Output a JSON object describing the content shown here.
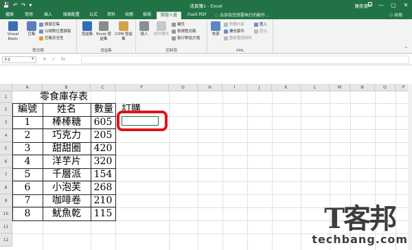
{
  "titlebar": {
    "doc_title": "活頁簿1 - Excel",
    "user": "陳奕安",
    "qat": {
      "save": "💾",
      "undo": "↶",
      "redo": "↷",
      "more": "▾"
    },
    "win": {
      "ribbon_opts": "▭",
      "minimize": "—",
      "maximize": "▢",
      "close": "✕"
    }
  },
  "ribbon_tabs": [
    "檔案",
    "常用",
    "插入",
    "版面配置",
    "公式",
    "資料",
    "校閱",
    "檢視",
    "開發人員",
    "Foxit PDF"
  ],
  "active_tab": "開發人員",
  "tell_me": "告訴我您想要執行的動作...",
  "share": "共用",
  "ribbon": {
    "code": {
      "visual_basic": "Visual Basic",
      "macros": "巨集",
      "record_macro": "錄製巨集",
      "relative_ref": "以相對位置錄製",
      "macro_security": "巨集安全性",
      "group": "程式碼"
    },
    "addins": {
      "addins": "增益集",
      "excel_addins": "Excel 增益集",
      "com_addins": "COM 增益集",
      "group": "增益集"
    },
    "controls": {
      "insert": "插入",
      "design_mode": "設計模式",
      "properties": "屬性",
      "view_code": "檢視程式碼",
      "run_dialog": "執行對話方塊",
      "group": "控制項"
    },
    "xml": {
      "source": "來源",
      "map_properties": "對應內容",
      "expansion_packs": "擴充套件",
      "refresh_data": "重新整理資料",
      "import": "匯入",
      "export": "匯出",
      "group": "XML"
    },
    "collapse": "^"
  },
  "formula_bar": {
    "name_box": "F3",
    "cancel": "✕",
    "enter": "✓",
    "fx": "fx",
    "formula": ""
  },
  "columns": [
    "A",
    "B",
    "C",
    "F",
    "G",
    "H",
    "I",
    "J",
    "K",
    "L",
    "M",
    "N",
    "O",
    "P"
  ],
  "rows": [
    "1",
    "2",
    "3",
    "4",
    "5",
    "6",
    "7",
    "8",
    "9",
    "10",
    "11",
    "12"
  ],
  "table": {
    "title": "零食庫存表",
    "headers": {
      "id": "編號",
      "name": "姓名",
      "qty": "數量",
      "order": "訂購"
    },
    "rows": [
      {
        "id": "1",
        "name": "棒棒糖",
        "qty": "605"
      },
      {
        "id": "2",
        "name": "巧克力",
        "qty": "205"
      },
      {
        "id": "3",
        "name": "甜甜圈",
        "qty": "420"
      },
      {
        "id": "4",
        "name": "洋芋片",
        "qty": "320"
      },
      {
        "id": "5",
        "name": "千層派",
        "qty": "154"
      },
      {
        "id": "6",
        "name": "小泡芙",
        "qty": "268"
      },
      {
        "id": "7",
        "name": "咖啡卷",
        "qty": "210"
      },
      {
        "id": "8",
        "name": "魷魚乾",
        "qty": "115"
      }
    ]
  },
  "watermark": {
    "logo": "T客邦",
    "site": "techbang.com"
  }
}
